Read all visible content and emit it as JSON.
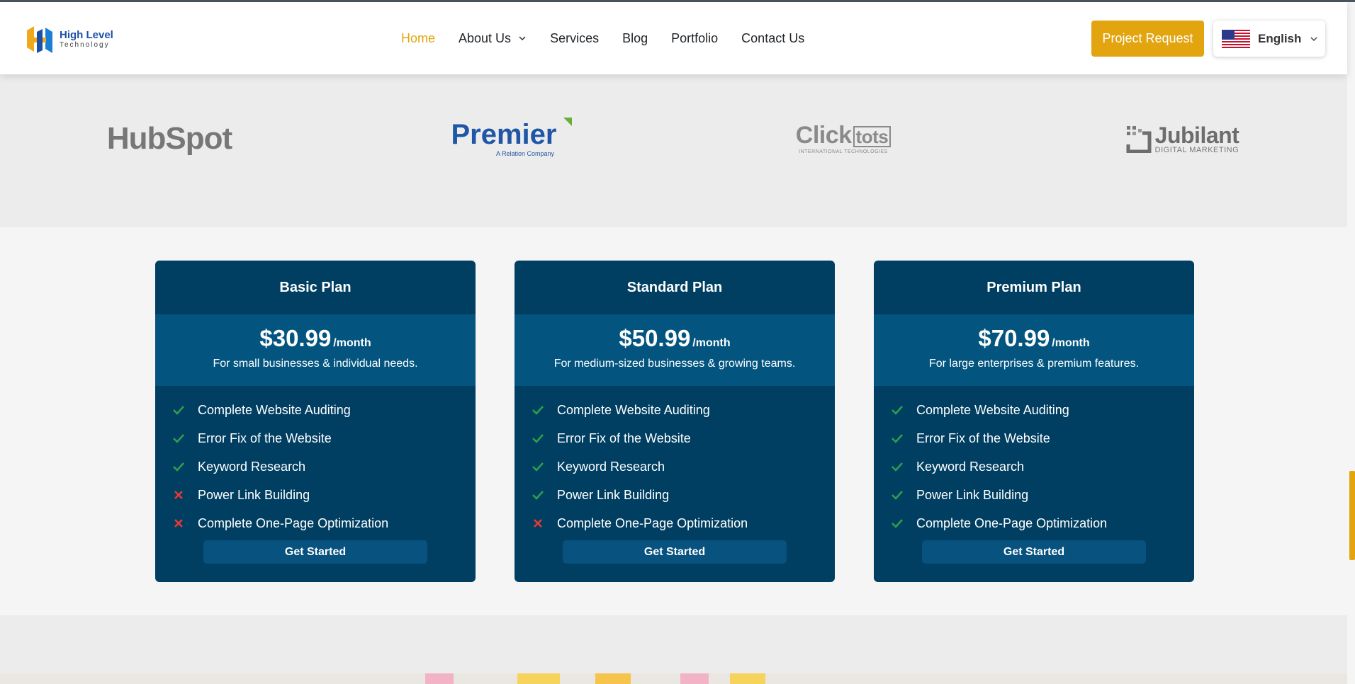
{
  "header": {
    "logo": {
      "title": "High Level",
      "subtitle": "Technology"
    },
    "nav": [
      {
        "label": "Home",
        "active": true
      },
      {
        "label": "About Us",
        "has_dropdown": true
      },
      {
        "label": "Services"
      },
      {
        "label": "Blog"
      },
      {
        "label": "Portfolio"
      },
      {
        "label": "Contact Us"
      }
    ],
    "project_button": "Project Request",
    "language": {
      "label": "English",
      "flag_icon": "us-flag-icon"
    }
  },
  "partners": [
    {
      "name": "HubSpot"
    },
    {
      "name": "Premier",
      "tagline": "A Relation Company"
    },
    {
      "name": "Click",
      "name_boxed": "tots",
      "tagline": "INTERNATIONAL TECHNOLOGIES"
    },
    {
      "name": "Jubilant",
      "tagline": "DIGITAL MARKETING"
    }
  ],
  "plans": [
    {
      "title": "Basic Plan",
      "price": "$30.99",
      "period": "/month",
      "description": "For small businesses & individual needs.",
      "features": [
        {
          "label": "Complete Website Auditing",
          "included": true
        },
        {
          "label": "Error Fix of the Website",
          "included": true
        },
        {
          "label": "Keyword Research",
          "included": true
        },
        {
          "label": "Power Link Building",
          "included": false
        },
        {
          "label": "Complete One-Page Optimization",
          "included": false
        }
      ],
      "cta": "Get Started"
    },
    {
      "title": "Standard Plan",
      "price": "$50.99",
      "period": "/month",
      "description": "For medium-sized businesses & growing teams.",
      "features": [
        {
          "label": "Complete Website Auditing",
          "included": true
        },
        {
          "label": "Error Fix of the Website",
          "included": true
        },
        {
          "label": "Keyword Research",
          "included": true
        },
        {
          "label": "Power Link Building",
          "included": true
        },
        {
          "label": "Complete One-Page Optimization",
          "included": false
        }
      ],
      "cta": "Get Started"
    },
    {
      "title": "Premium Plan",
      "price": "$70.99",
      "period": "/month",
      "description": "For large enterprises & premium features.",
      "features": [
        {
          "label": "Complete Website Auditing",
          "included": true
        },
        {
          "label": "Error Fix of the Website",
          "included": true
        },
        {
          "label": "Keyword Research",
          "included": true
        },
        {
          "label": "Power Link Building",
          "included": true
        },
        {
          "label": "Complete One-Page Optimization",
          "included": true
        }
      ],
      "cta": "Get Started"
    }
  ],
  "colors": {
    "accent": "#e2a510",
    "card_bg": "#003f62",
    "price_band": "#035580",
    "check": "#2e9e4f",
    "cross": "#e53935"
  }
}
